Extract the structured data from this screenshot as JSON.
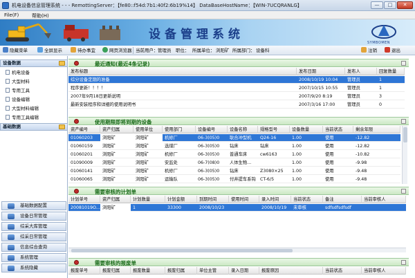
{
  "window": {
    "title": "机电设备信息管理系统 - - - RemottingServer：【fe80::f54d:7b1:40f2:6b19%14】 DataBaseHostName：【WIN-7UCQRANLG】",
    "min_glyph": "—",
    "max_glyph": "□",
    "close_glyph": "✕"
  },
  "menu": {
    "file": "File(F)",
    "help": "帮助(H)"
  },
  "banner": {
    "system_title": "设备管理系统",
    "logo_text": "SYMBOMEN"
  },
  "toolbar": {
    "hide_menu": "隐藏菜单",
    "fullscreen": "全屏显示",
    "todo": "待办事宜",
    "browser": "网页浏览器",
    "current_user_label": "当前用户：",
    "current_user": "管理员",
    "position_label": "职位：",
    "mine_label": "所属单位：",
    "mine": "浏阳矿",
    "dept_label": "所属部门：",
    "dept": "设备科",
    "logout": "注销",
    "exit": "退出"
  },
  "left_panel": {
    "equip_data": "设备数据",
    "tree": [
      "机电设备",
      "大型材料",
      "专用工具",
      "设备编辑",
      "大型材料编辑",
      "专用工具编辑"
    ],
    "base_data": "基础数据",
    "nav": [
      "基础数据配置",
      "设备日常管理",
      "综采大库管理",
      "综采日常管理",
      "信息综合查询",
      "系统管理",
      "系统隐藏"
    ]
  },
  "notices": {
    "title": "最近通知(最近4条记录)",
    "columns": [
      "发布标题",
      "发布日期",
      "发布人",
      "回复数量"
    ],
    "rows": [
      [
        "综分设备定期的准备",
        "2008/10/19 10:04",
        "管理员",
        "1"
      ],
      [
        "程序更新！！！！",
        "2007/10/15 10:55",
        "管理员",
        "1"
      ],
      [
        "2007年9月18日更新说明",
        "2007/9/20 8:19",
        "管理员",
        "3"
      ],
      [
        "最新安装程序和详细的使用说明书",
        "2007/3/16 17:00",
        "管理员",
        "0"
      ]
    ]
  },
  "expiry": {
    "title": "使用期限即将到期的设备",
    "columns": [
      "资产编号",
      "资产归属",
      "使用单位",
      "使用部门",
      "设备编号",
      "设备名称",
      "规格型号",
      "设备数量",
      "当前状态",
      "剩余年限"
    ],
    "rows": [
      [
        "01060203",
        "浏阳矿",
        "浏阳矿",
        "机修厂",
        "06-3(05)0",
        "耿合冲型机",
        "Q24-16",
        "1.00",
        "使用",
        "-12.82"
      ],
      [
        "01060159",
        "浏阳矿",
        "浏阳矿",
        "选煤厂",
        "06-3(05)0",
        "钻床",
        "钻床",
        "1.00",
        "使用",
        "-12.82"
      ],
      [
        "01060201",
        "浏阳矿",
        "浏阳矿",
        "机修厂",
        "06-3(05)0",
        "普通车床",
        "cw6163",
        "1.00",
        "使用",
        "-10.82"
      ],
      [
        "01090009",
        "浏阳矿",
        "浏阳矿",
        "安监处",
        "06-7(08)0",
        "人体生物...",
        "",
        "1.00",
        "使用",
        "-9.98"
      ],
      [
        "01060141",
        "浏阳矿",
        "浏阳矿",
        "机修厂",
        "06-3(05)0",
        "钻床",
        "Z3080×25",
        "1.00",
        "使用",
        "-9.48"
      ],
      [
        "01060065",
        "浏阳矿",
        "浏阳矿",
        "运输队",
        "06-3(05)0",
        "付井提车系钩",
        "CT-6/5",
        "1.00",
        "使用",
        "-9.48"
      ]
    ]
  },
  "plans": {
    "title": "需要审核的计划单",
    "columns": [
      "计划单号",
      "资产归属",
      "计划数量",
      "计划金额",
      "到期时间",
      "使用时间",
      "录入时间",
      "当前状态",
      "备注",
      "当前审核人"
    ],
    "rows": [
      [
        "20081019O...",
        "浏阳矿",
        "1",
        "33300",
        "2008/10/23",
        "",
        "2008/10/19",
        "未审核",
        "sdfsdfsdfsdf",
        ""
      ]
    ]
  },
  "scrap": {
    "title": "需要审核的报废单",
    "columns": [
      "报废单号",
      "报废归属",
      "报废数量",
      "报废归属",
      "单位主管",
      "录入日期",
      "报废原因",
      "当前状态",
      "当前审核人"
    ]
  }
}
